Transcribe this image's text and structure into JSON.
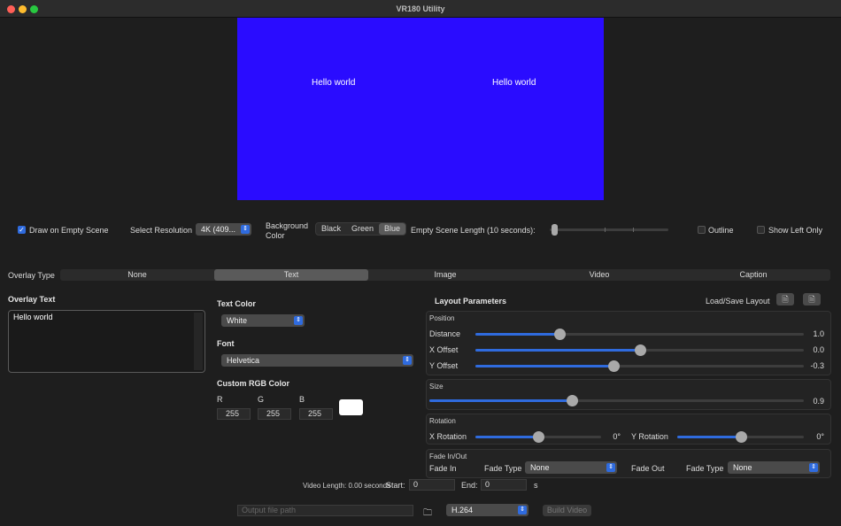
{
  "window": {
    "title": "VR180 Utility"
  },
  "preview": {
    "background": "#2a0cff",
    "left_text": "Hello world",
    "right_text": "Hello world"
  },
  "controls": {
    "draw_empty_label": "Draw on Empty Scene",
    "draw_empty_checked": true,
    "resolution_label": "Select Resolution",
    "resolution_value": "4K (409...",
    "background_color_label_1": "Background",
    "background_color_label_2": "Color",
    "bg_options": [
      "Black",
      "Green",
      "Blue"
    ],
    "bg_selected": "Blue",
    "empty_scene_length_label": "Empty Scene Length (10 seconds):",
    "outline_label": "Outline",
    "show_left_only_label": "Show Left Only"
  },
  "overlay": {
    "type_label": "Overlay Type",
    "tabs": [
      "None",
      "Text",
      "Image",
      "Video",
      "Caption"
    ],
    "selected_tab": "Text",
    "overlay_text_label": "Overlay Text",
    "overlay_text_value": "Hello world"
  },
  "text_panel": {
    "text_color_label": "Text Color",
    "text_color_value": "White",
    "font_label": "Font",
    "font_value": "Helvetica",
    "custom_rgb_label": "Custom RGB Color",
    "r_label": "R",
    "g_label": "G",
    "b_label": "B",
    "r_value": "255",
    "g_value": "255",
    "b_value": "255",
    "swatch_color": "#ffffff"
  },
  "layout": {
    "title": "Layout Parameters",
    "load_save_label": "Load/Save Layout",
    "position_label": "Position",
    "distance_label": "Distance",
    "distance_value": "1.0",
    "distance_level": 0.255,
    "x_offset_label": "X Offset",
    "x_offset_value": "0.0",
    "x_offset_level": 0.5,
    "y_offset_label": "Y Offset",
    "y_offset_value": "-0.3",
    "y_offset_level": 0.42,
    "size_label": "Size",
    "size_value": "0.9",
    "size_level": 0.38,
    "rotation_label": "Rotation",
    "x_rotation_label": "X Rotation",
    "x_rotation_value": "0°",
    "x_rotation_level": 0.5,
    "y_rotation_label": "Y Rotation",
    "y_rotation_value": "0°",
    "y_rotation_level": 0.5,
    "fade_label": "Fade In/Out",
    "fade_in_label": "Fade In",
    "fade_type_label": "Fade Type",
    "fade_in_type": "None",
    "fade_out_label": "Fade Out",
    "fade_out_type": "None"
  },
  "timing": {
    "video_length_label": "Video Length: 0.00 seconds",
    "start_label": "Start:",
    "start_value": "0",
    "end_label": "End:",
    "end_value": "0",
    "unit": "s"
  },
  "output": {
    "path_placeholder": "Output file path",
    "codec_value": "H.264",
    "build_label": "Build Video"
  }
}
